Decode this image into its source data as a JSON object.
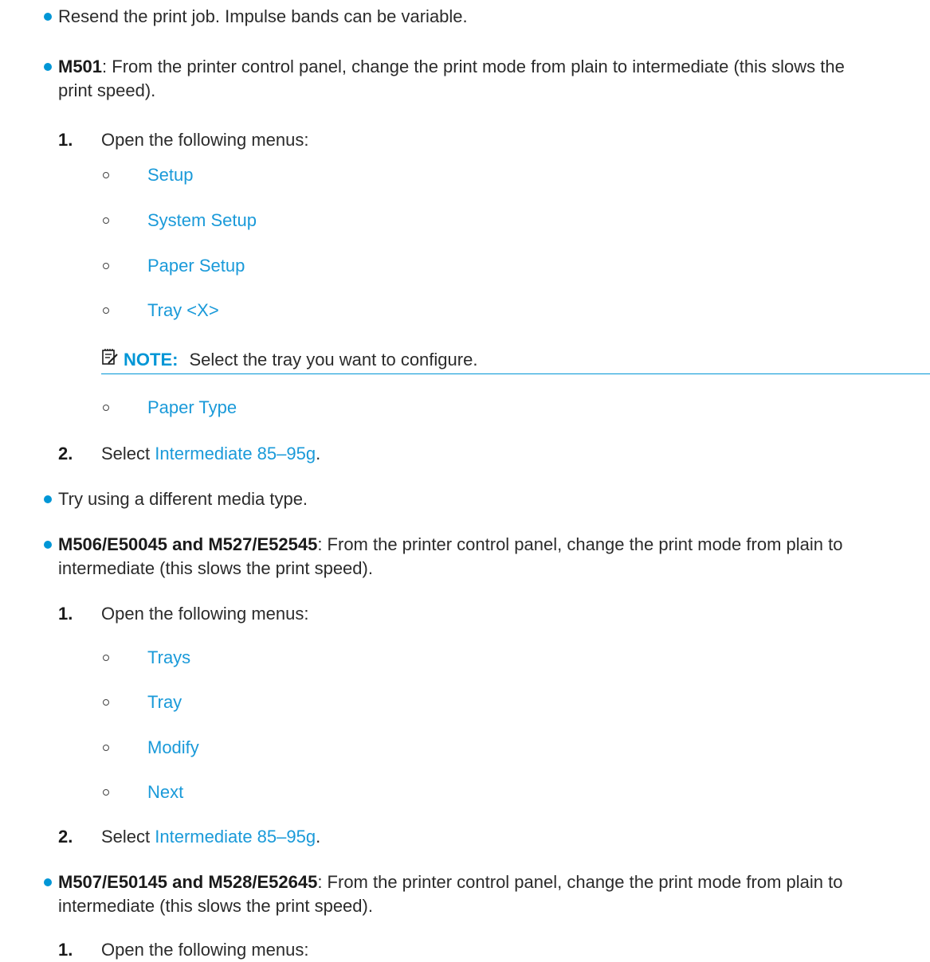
{
  "b1": "Resend the print job. Impulse bands can be variable.",
  "b2": {
    "model": "M501",
    "l1": ": From the printer control panel, change the print mode from plain to intermediate (this slows the",
    "l2": "print speed).",
    "s1": {
      "num": "1.",
      "text": "Open the following menus:"
    },
    "menus": [
      "Setup",
      "System Setup",
      "Paper Setup",
      "Tray <X>",
      "Paper Type"
    ],
    "note": {
      "label": "NOTE:",
      "text": "Select the tray you want to configure."
    },
    "s2": {
      "num": "2.",
      "pre": "Select ",
      "link": "Intermediate 85–95g",
      "post": "."
    }
  },
  "b3": "Try using a different media type.",
  "b4": {
    "model": "M506/E50045 and M527/E52545",
    "l1": ": From the printer control panel, change the print mode from plain to",
    "l2": "intermediate (this slows the print speed).",
    "s1": {
      "num": "1.",
      "text": "Open the following menus:"
    },
    "menus": [
      "Trays",
      "Tray",
      "Modify",
      "Next"
    ],
    "s2": {
      "num": "2.",
      "pre": "Select ",
      "link": "Intermediate 85–95g",
      "post": "."
    }
  },
  "b5": {
    "model": "M507/E50145 and M528/E52645",
    "l1": ": From the printer control panel, change the print mode from plain to",
    "l2": "intermediate (this slows the print speed).",
    "s1": {
      "num": "1.",
      "text": "Open the following menus:"
    }
  }
}
